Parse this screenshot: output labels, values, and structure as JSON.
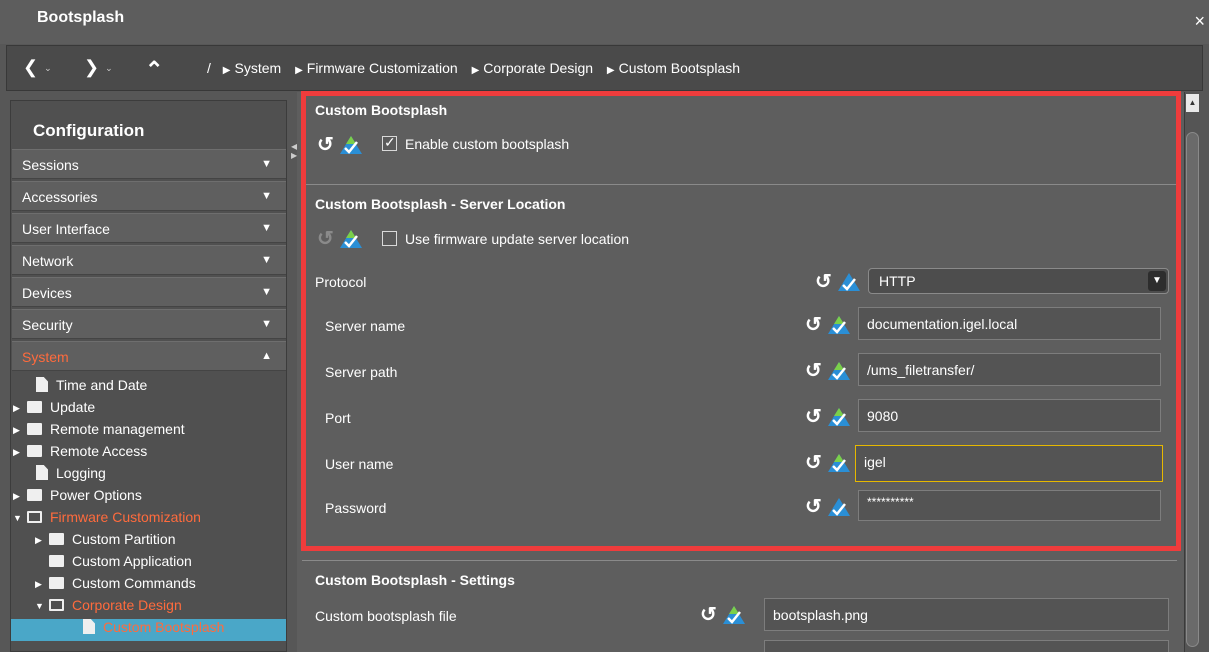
{
  "window": {
    "title": "Bootsplash",
    "close_glyph": "×"
  },
  "nav": {
    "back_glyph": "❮",
    "forward_glyph": "❯",
    "up_glyph": "⌃",
    "dropdown_glyph": "⌄",
    "root_slash": "/",
    "breadcrumbs": [
      "System",
      "Firmware Customization",
      "Corporate Design",
      "Custom Bootsplash"
    ]
  },
  "sidebar": {
    "title": "Configuration",
    "categories": [
      {
        "label": "Sessions",
        "arrow": "▼"
      },
      {
        "label": "Accessories",
        "arrow": "▼"
      },
      {
        "label": "User Interface",
        "arrow": "▼"
      },
      {
        "label": "Network",
        "arrow": "▼"
      },
      {
        "label": "Devices",
        "arrow": "▼"
      },
      {
        "label": "Security",
        "arrow": "▼"
      },
      {
        "label": "System",
        "arrow": "▲"
      }
    ],
    "tree": [
      "Time and Date",
      "Update",
      "Remote management",
      "Remote Access",
      "Logging",
      "Power Options",
      "Firmware Customization",
      "Custom Partition",
      "Custom Application",
      "Custom Commands",
      "Corporate Design",
      "Custom Bootsplash"
    ]
  },
  "main": {
    "custom_bootsplash": {
      "title": "Custom Bootsplash",
      "enable_label": "Enable custom bootsplash",
      "enable_checked": true
    },
    "server_location": {
      "title": "Custom Bootsplash - Server Location",
      "use_fw_label": "Use firmware update server location",
      "use_fw_checked": false,
      "protocol_label": "Protocol",
      "protocol_value": "HTTP",
      "server_name_label": "Server name",
      "server_name_value": "documentation.igel.local",
      "server_path_label": "Server path",
      "server_path_value": "/ums_filetransfer/",
      "port_label": "Port",
      "port_value": "9080",
      "user_name_label": "User name",
      "user_name_value": "igel",
      "password_label": "Password",
      "password_value": "**********"
    },
    "settings": {
      "title": "Custom Bootsplash - Settings",
      "file_label": "Custom bootsplash file",
      "file_value": "bootsplash.png"
    }
  },
  "colors": {
    "highlight": "#ef3c3c",
    "active_orange": "#ff6b3d",
    "selected_blue": "#4aa7c8",
    "focus_yellow": "#e6b800"
  },
  "icons": {
    "reset": "reset-arrow-icon",
    "apply": "triangle-check-icon"
  }
}
